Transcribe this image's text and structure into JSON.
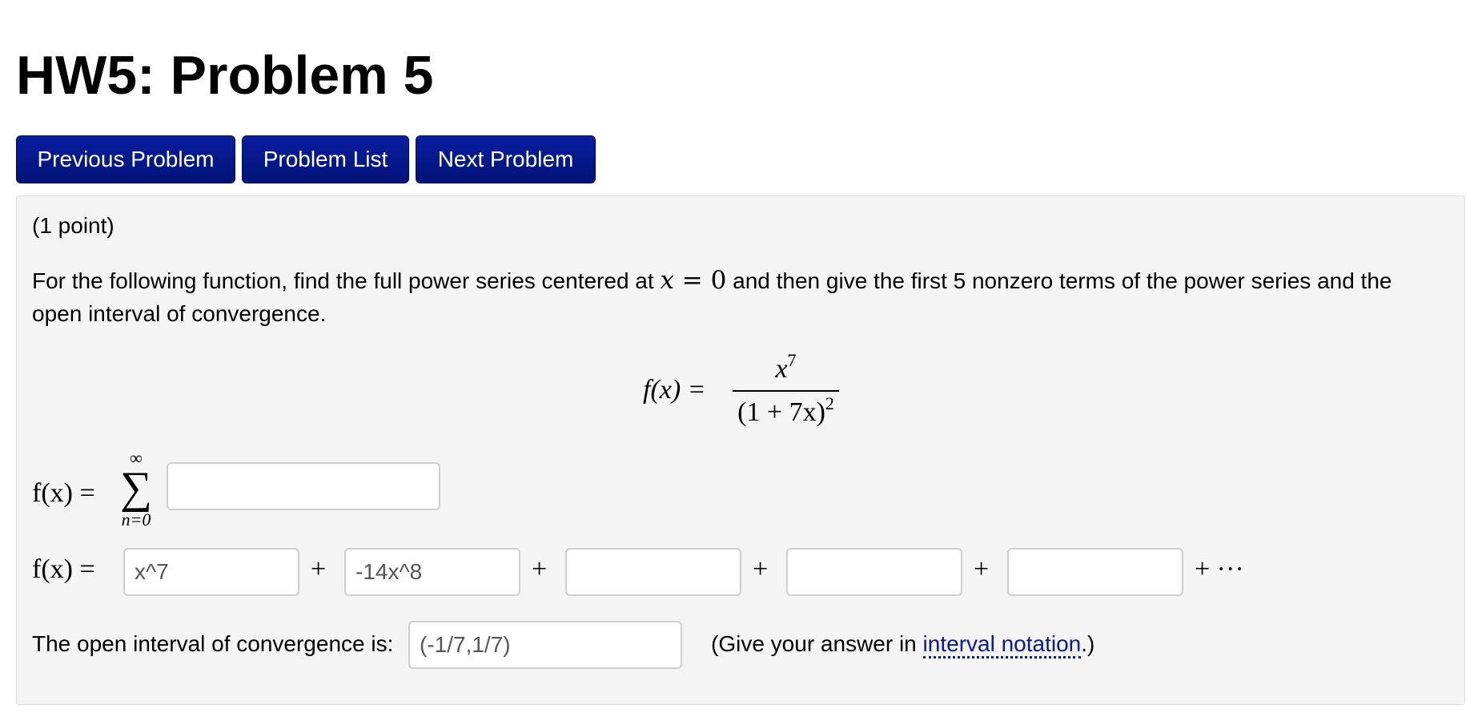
{
  "page": {
    "title": "HW5: Problem 5"
  },
  "nav": {
    "previous_label": "Previous Problem",
    "list_label": "Problem List",
    "next_label": "Next Problem"
  },
  "problem": {
    "points": "(1 point)",
    "prompt_before": "For the following function, find the full power series centered at ",
    "prompt_var": "x",
    "prompt_eq": " = ",
    "prompt_zero": "0",
    "prompt_after": " and then give the first 5 nonzero terms of the power series and the open interval of convergence.",
    "function": {
      "lhs": "f(x) =",
      "numerator_base": "x",
      "numerator_exp": "7",
      "denominator_base": "(1 + 7x)",
      "denominator_exp": "2"
    },
    "series": {
      "lhs": "f(x) =",
      "upper": "∞",
      "sigma": "∑",
      "lower": "n=0",
      "value": ""
    },
    "terms": {
      "lhs": "f(x) =",
      "values": [
        "x^7",
        "-14x^8",
        "",
        "",
        ""
      ],
      "plus": "+",
      "tail": "+ ···"
    },
    "interval": {
      "label": "The open interval of convergence is:",
      "value": "(-1/7,1/7)",
      "hint_before": "(Give your answer in ",
      "hint_link": "interval notation",
      "hint_after": ".)"
    }
  },
  "colors": {
    "nav_button": "#011377",
    "panel_bg": "#f4f4f4",
    "link": "#0a1a8c"
  }
}
